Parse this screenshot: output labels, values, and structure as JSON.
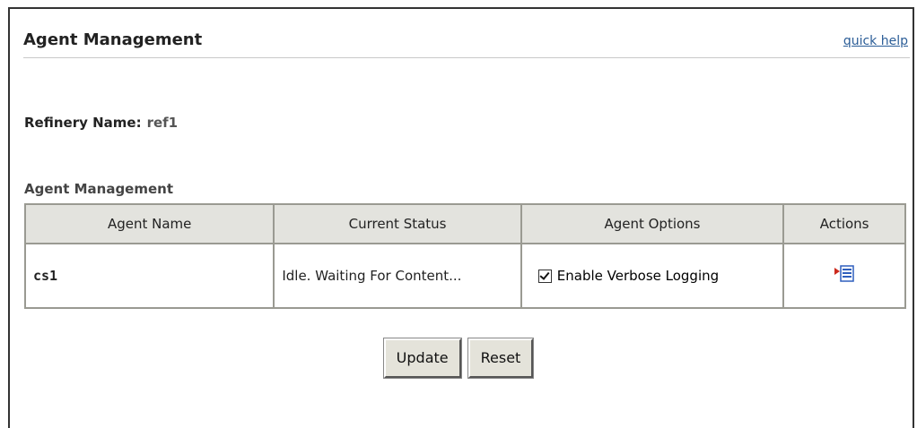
{
  "header": {
    "title": "Agent Management",
    "quick_help_label": "quick help"
  },
  "refinery": {
    "label": "Refinery Name:",
    "value": "ref1"
  },
  "section": {
    "title": "Agent Management"
  },
  "table": {
    "columns": [
      "Agent Name",
      "Current Status",
      "Agent Options",
      "Actions"
    ],
    "rows": [
      {
        "agent_name": "cs1",
        "status": "Idle. Waiting For Content...",
        "option_label": "Enable Verbose Logging",
        "option_checked": true,
        "action_icon": "properties-icon"
      }
    ]
  },
  "buttons": {
    "update_label": "Update",
    "reset_label": "Reset"
  },
  "colors": {
    "link": "#2b5d97",
    "header_bg": "#e3e3de",
    "border": "#9a9a92",
    "button_bg": "#e4e3da",
    "icon_blue": "#2f5fbd",
    "icon_red": "#cc2a1d"
  }
}
